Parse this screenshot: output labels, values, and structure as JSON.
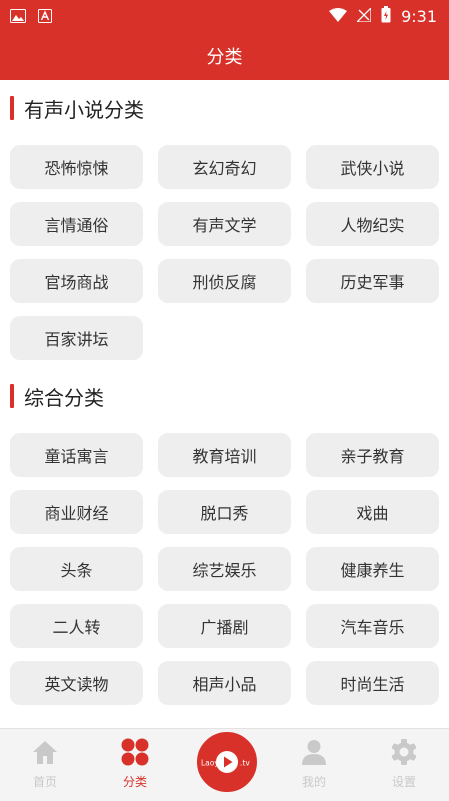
{
  "status_bar": {
    "time": "9:31",
    "icons": [
      "image-icon",
      "text-a-icon",
      "wifi-icon",
      "signal-off-icon",
      "battery-icon"
    ]
  },
  "header": {
    "title": "分类"
  },
  "sections": [
    {
      "title": "有声小说分类",
      "items": [
        "恐怖惊悚",
        "玄幻奇幻",
        "武侠小说",
        "言情通俗",
        "有声文学",
        "人物纪实",
        "官场商战",
        "刑侦反腐",
        "历史军事",
        "百家讲坛"
      ]
    },
    {
      "title": "综合分类",
      "items": [
        "童话寓言",
        "教育培训",
        "亲子教育",
        "商业财经",
        "脱口秀",
        "戏曲",
        "头条",
        "综艺娱乐",
        "健康养生",
        "二人转",
        "广播剧",
        "汽车音乐",
        "英文读物",
        "相声小品",
        "时尚生活"
      ]
    }
  ],
  "tabbar": {
    "tabs": [
      {
        "label": "首页",
        "icon": "home-icon"
      },
      {
        "label": "分类",
        "icon": "category-grid-icon",
        "active": true
      },
      {
        "label": "我的",
        "icon": "user-icon"
      },
      {
        "label": "设置",
        "icon": "gear-icon"
      }
    ],
    "center_logo": {
      "text": "Laoyu.tv",
      "icon": "play-icon"
    }
  },
  "colors": {
    "primary": "#d8312a",
    "chip_bg": "#eeeeee",
    "tab_inactive": "#c9c9c9"
  }
}
